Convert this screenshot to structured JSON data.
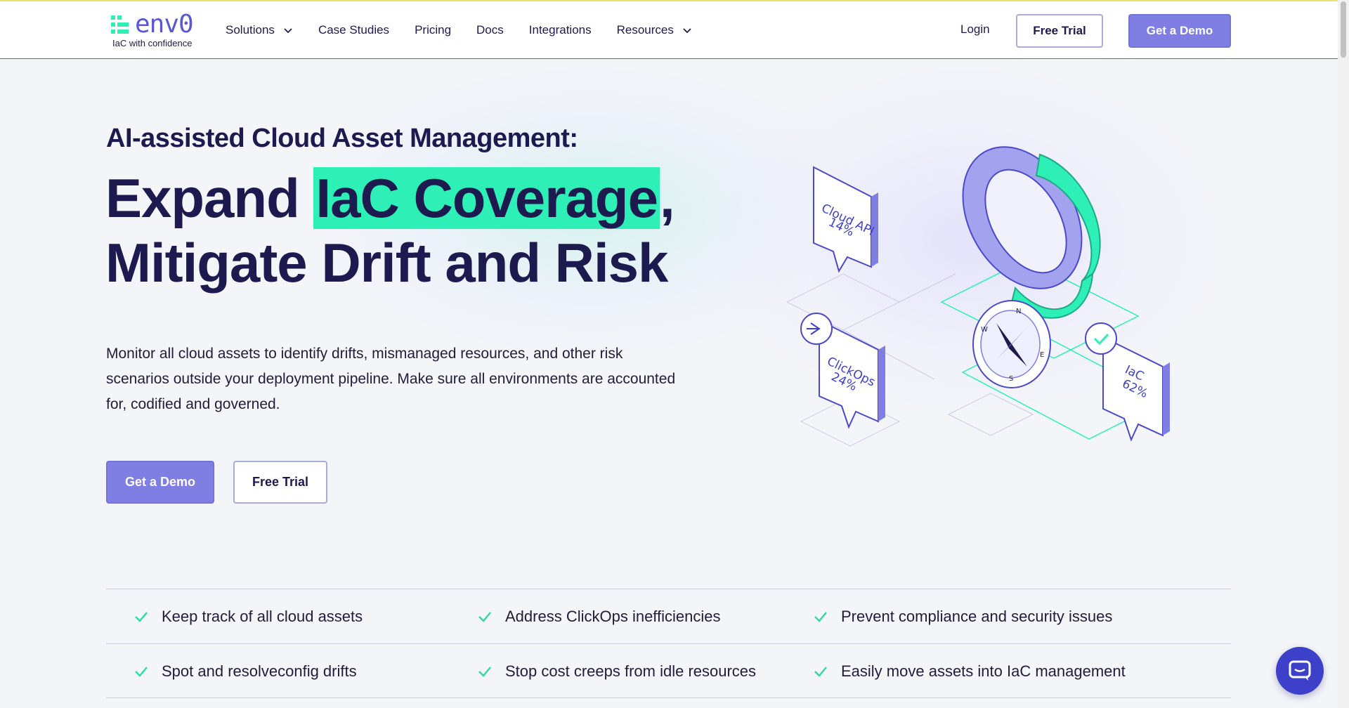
{
  "brand": {
    "name": "env0",
    "tagline": "IaC with confidence",
    "colors": {
      "primary": "#5a57d6",
      "accent": "#2ef0b7",
      "button": "#7f7ee3",
      "text": "#1c1a4f"
    }
  },
  "nav": {
    "items": [
      {
        "label": "Solutions",
        "has_dropdown": true
      },
      {
        "label": "Case Studies",
        "has_dropdown": false
      },
      {
        "label": "Pricing",
        "has_dropdown": false
      },
      {
        "label": "Docs",
        "has_dropdown": false
      },
      {
        "label": "Integrations",
        "has_dropdown": false
      },
      {
        "label": "Resources",
        "has_dropdown": true
      }
    ],
    "login": "Login",
    "free_trial": "Free Trial",
    "get_demo": "Get a Demo"
  },
  "hero": {
    "eyebrow": "AI-assisted Cloud Asset Management:",
    "headline_pre": "Expand ",
    "headline_highlight": "IaC Coverage",
    "headline_post": ",",
    "headline_line2": "Mitigate Drift and Risk",
    "description": "Monitor all cloud assets to identify drifts, mismanaged resources, and other risk scenarios outside your deployment pipeline. Make sure all environments are accounted for, codified and governed.",
    "cta_demo": "Get a Demo",
    "cta_trial": "Free Trial"
  },
  "illustration": {
    "labels": [
      {
        "name": "Cloud API",
        "value": "14%"
      },
      {
        "name": "ClickOps",
        "value": "24%"
      },
      {
        "name": "IaC",
        "value": "62%"
      }
    ],
    "compass": [
      "N",
      "E",
      "S",
      "W"
    ]
  },
  "features": [
    [
      "Keep track of all cloud assets",
      "Address ClickOps inefficiencies",
      "Prevent compliance and security issues"
    ],
    [
      "Spot and resolveconfig drifts",
      "Stop cost creeps from idle resources",
      "Easily move assets into IaC management"
    ]
  ],
  "icons": {
    "chevron": "chevron-down-icon",
    "check": "check-icon",
    "chat": "chat-icon"
  }
}
